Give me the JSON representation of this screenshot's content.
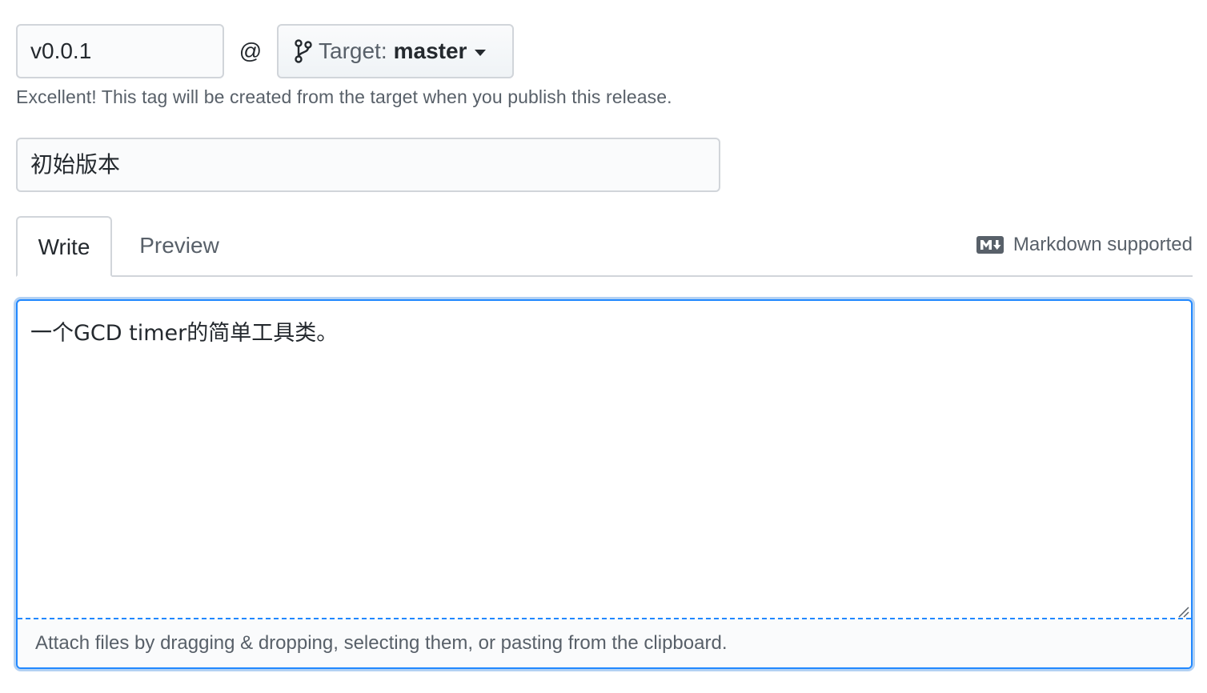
{
  "tag": {
    "value": "v0.0.1",
    "at_symbol": "@",
    "target_label": "Target:",
    "target_value": "master"
  },
  "hint_text": "Excellent! This tag will be created from the target when you publish this release.",
  "title_input": {
    "value": "初始版本"
  },
  "tabs": [
    {
      "label": "Write",
      "active": true
    },
    {
      "label": "Preview",
      "active": false
    }
  ],
  "markdown": {
    "icon": "markdown-icon",
    "label": "Markdown supported"
  },
  "editor": {
    "value": "一个GCD timer的简单工具类。",
    "attach_hint": "Attach files by dragging & dropping, selecting them, or pasting from the clipboard."
  },
  "colors": {
    "focus_border": "#2188ff",
    "muted_text": "#586069",
    "border": "#d1d5da"
  }
}
